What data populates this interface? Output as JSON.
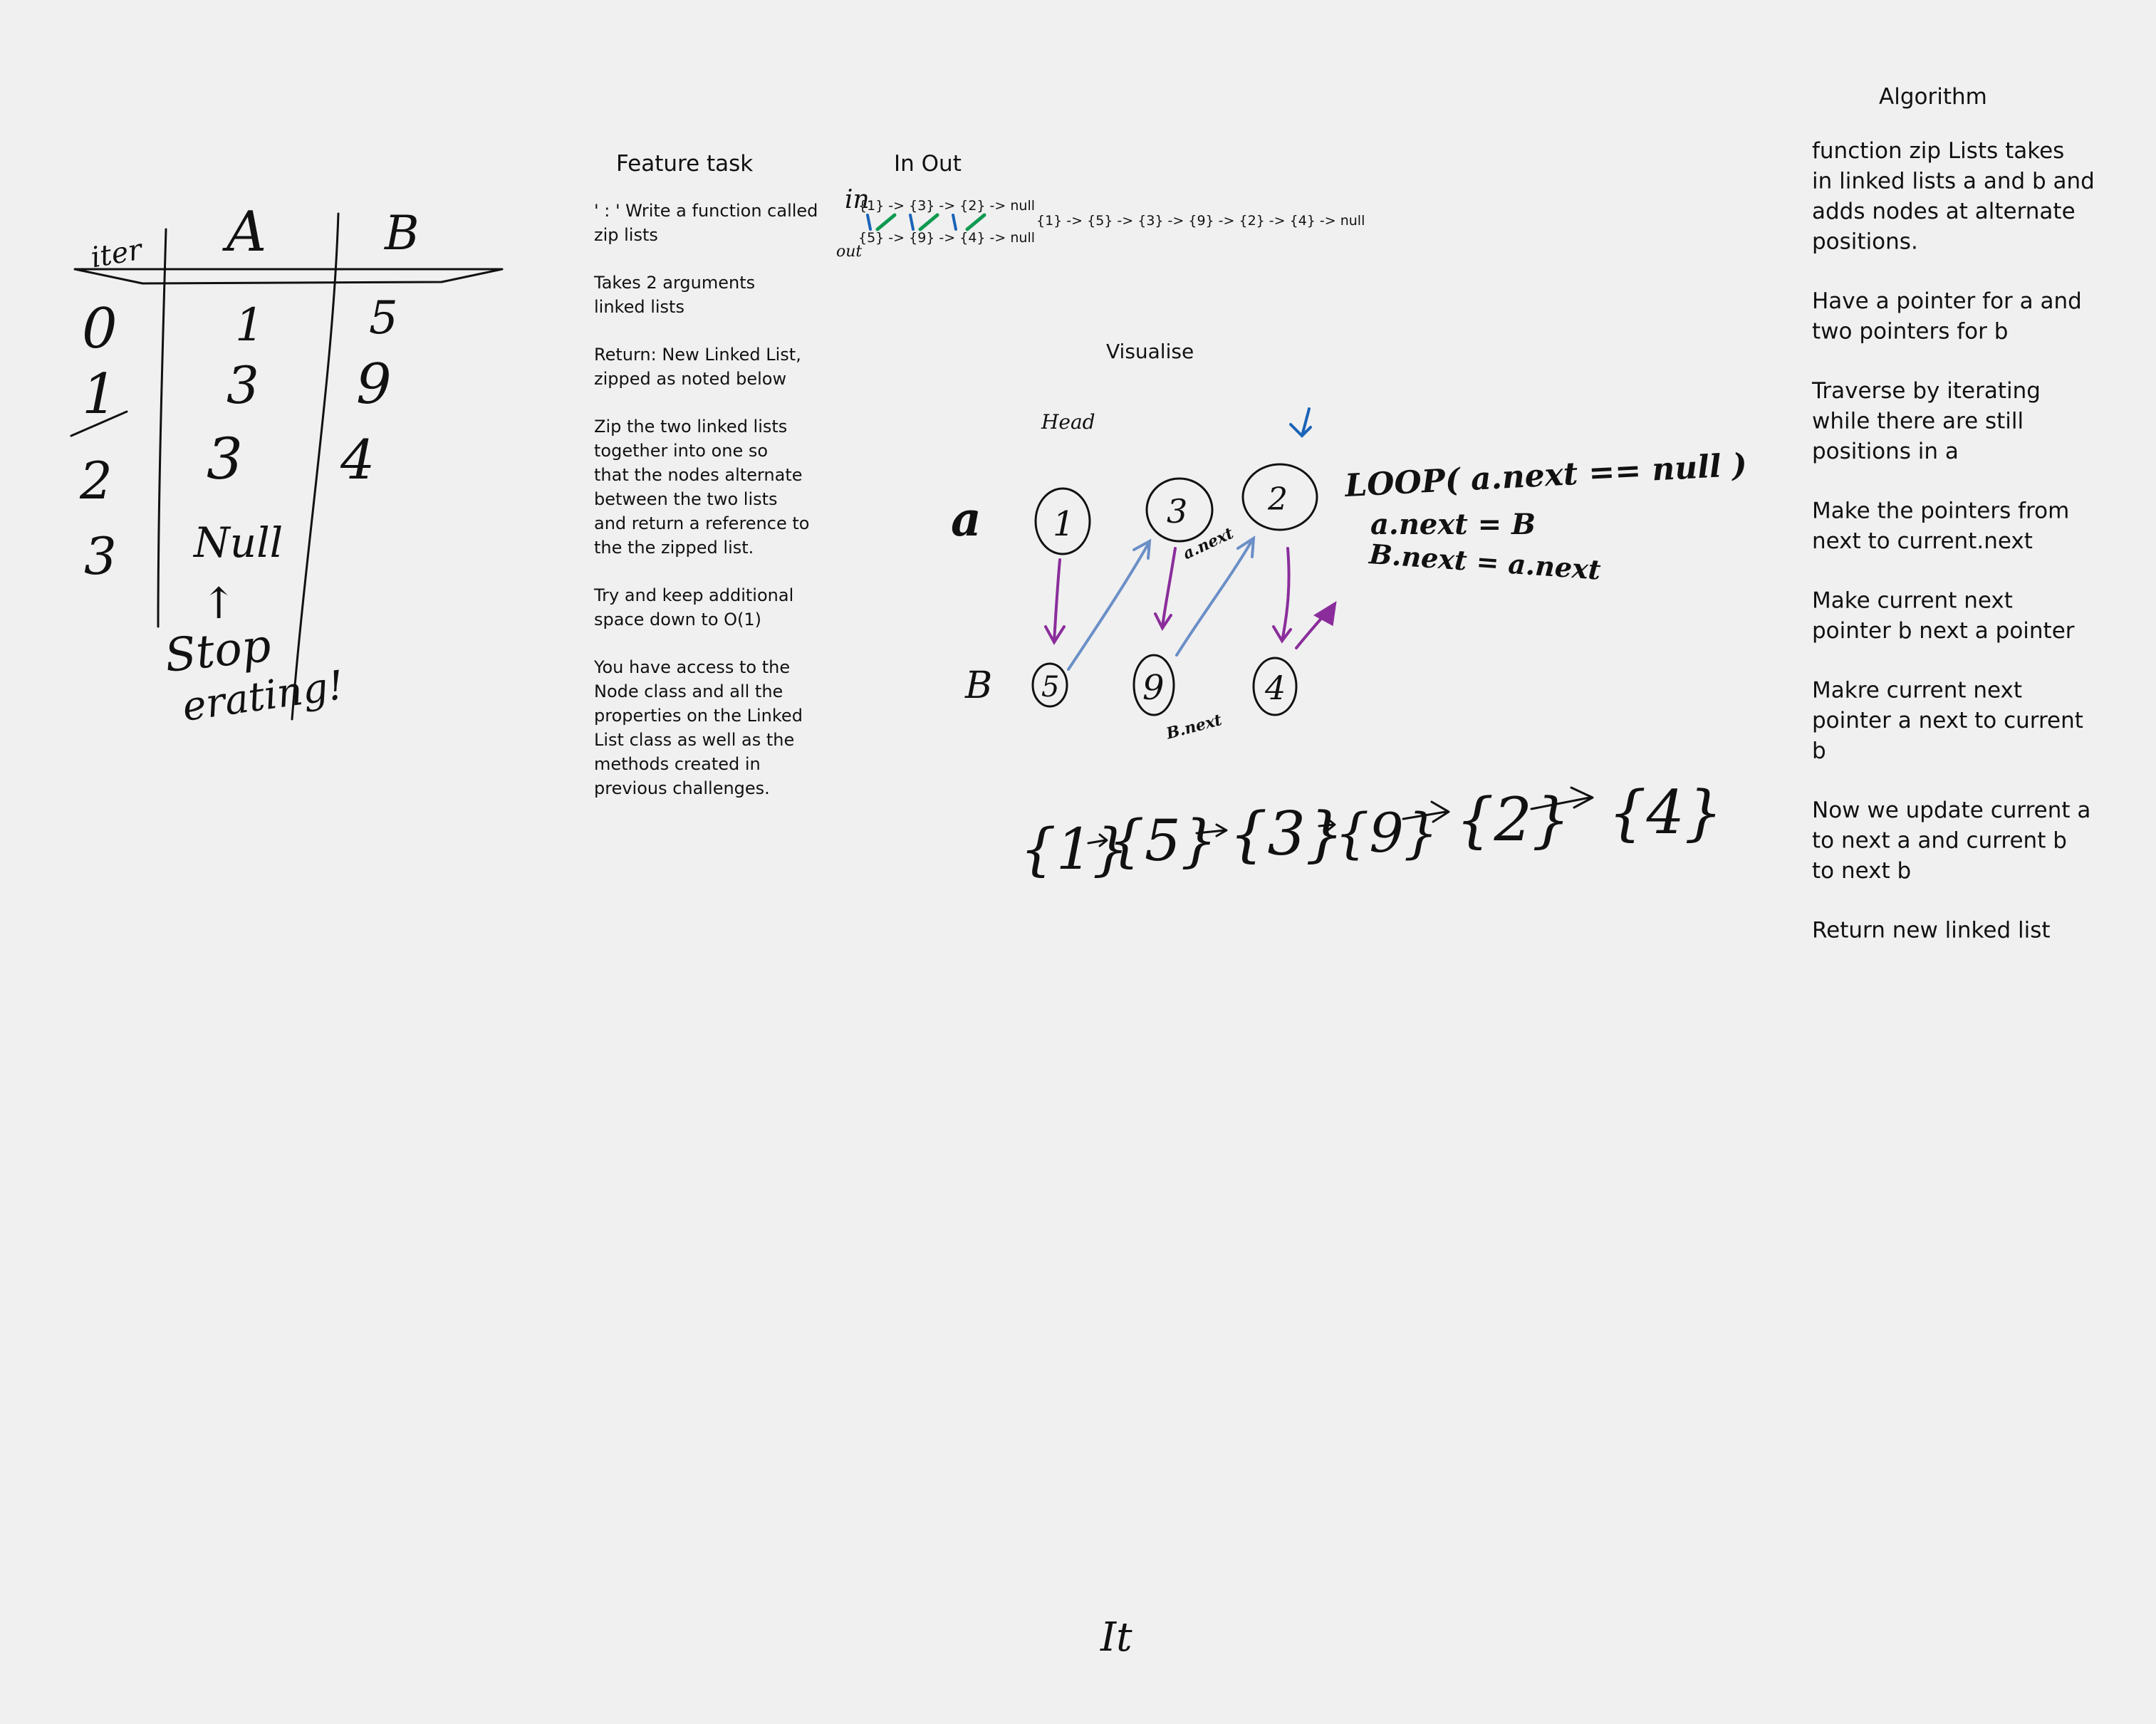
{
  "table": {
    "headers": [
      "iter",
      "A",
      "B"
    ],
    "rows": [
      {
        "iter": "0",
        "a": "1",
        "b": "5"
      },
      {
        "iter": "1",
        "a": "3",
        "b": "9"
      },
      {
        "iter": "2",
        "a": "3",
        "b": "4"
      },
      {
        "iter": "3",
        "a": "Null",
        "b": ""
      }
    ],
    "arrow": "↑",
    "note_line1": "Stop",
    "note_line2": "erating!"
  },
  "feature": {
    "title": "Feature task",
    "paragraphs": [
      [
        "' : ' Write a function called",
        "zip lists"
      ],
      [
        "Takes 2 arguments",
        "linked lists"
      ],
      [
        "Return: New Linked List,",
        "zipped as noted below"
      ],
      [
        "Zip the two linked lists",
        "together into one so",
        "that the nodes alternate",
        "between the two lists",
        "and return a reference to",
        "the the zipped list."
      ],
      [
        "Try and keep additional",
        "space down to O(1)"
      ],
      [
        "You have access to the",
        "Node class and all the",
        "properties on the Linked",
        "List class as well as the",
        "methods created in",
        "previous challenges."
      ]
    ]
  },
  "io": {
    "title": "In Out",
    "in_label": "in",
    "out_label": "out",
    "list_a": "{1} -> {3} -> {2} -> null",
    "list_b": "{5} -> {9} -> {4} -> null",
    "output": "{1} -> {5} -> {3} -> {9} -> {2} -> {4} -> null"
  },
  "visualise": {
    "title": "Visualise",
    "head_label": "Head",
    "row_a_label": "a",
    "row_b_label": "B",
    "nodes_a": [
      "1",
      "3",
      "2"
    ],
    "nodes_b": [
      "5",
      "9",
      "4"
    ],
    "anext_label": "a.next",
    "bnext_label": "B.next",
    "loop_line1": "LOOP( a.next == null )",
    "loop_line2": "a.next = B",
    "loop_line3": "B.next = a.next",
    "zipped": [
      "{1}",
      "{5}",
      "{3}",
      "{9}",
      "{2}",
      "{4}"
    ]
  },
  "algorithm": {
    "title": "Algorithm",
    "paragraphs": [
      [
        "function zip Lists takes",
        "in linked lists a and b and",
        "adds nodes at alternate",
        "positions."
      ],
      [
        "Have a pointer for a and",
        "two pointers for b"
      ],
      [
        "Traverse by iterating",
        "while there are still",
        "positions in a"
      ],
      [
        "Make the pointers from",
        "next to current.next"
      ],
      [
        "Make current next",
        "pointer b next a pointer"
      ],
      [
        "Makre current next",
        "pointer a next to current",
        "b"
      ],
      [
        "Now we update current a",
        "to next a and current b",
        "to next b"
      ],
      [
        "Return new linked list"
      ]
    ]
  },
  "footer_mark": "It",
  "colors": {
    "background": "#f0f0f0",
    "ink": "#111111",
    "green": "#0f9950",
    "purple": "#8a2d9b",
    "blue": "#6b8fc7",
    "dark_blue": "#1a63b8",
    "red": "#d4232f"
  }
}
